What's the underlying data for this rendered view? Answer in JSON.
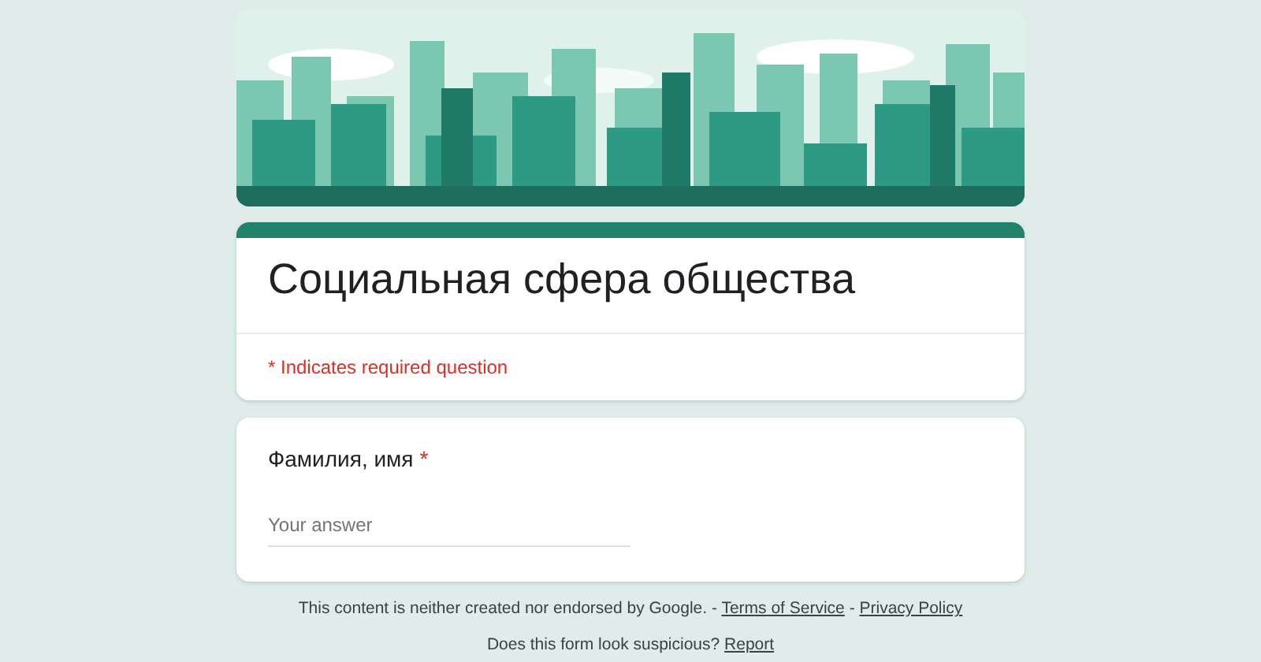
{
  "title": "Социальная сфера общества",
  "required_note": "* Indicates required question",
  "required_mark": "*",
  "questions": [
    {
      "label": "Фамилия, имя",
      "required": true,
      "placeholder": "Your answer"
    }
  ],
  "footer": {
    "disclaimer": "This content is neither created nor endorsed by Google. -",
    "links": [
      "Terms of Service",
      "Privacy Policy"
    ],
    "link_separator": "-",
    "question": "Does this form look suspicious?",
    "report_link": "Report"
  }
}
